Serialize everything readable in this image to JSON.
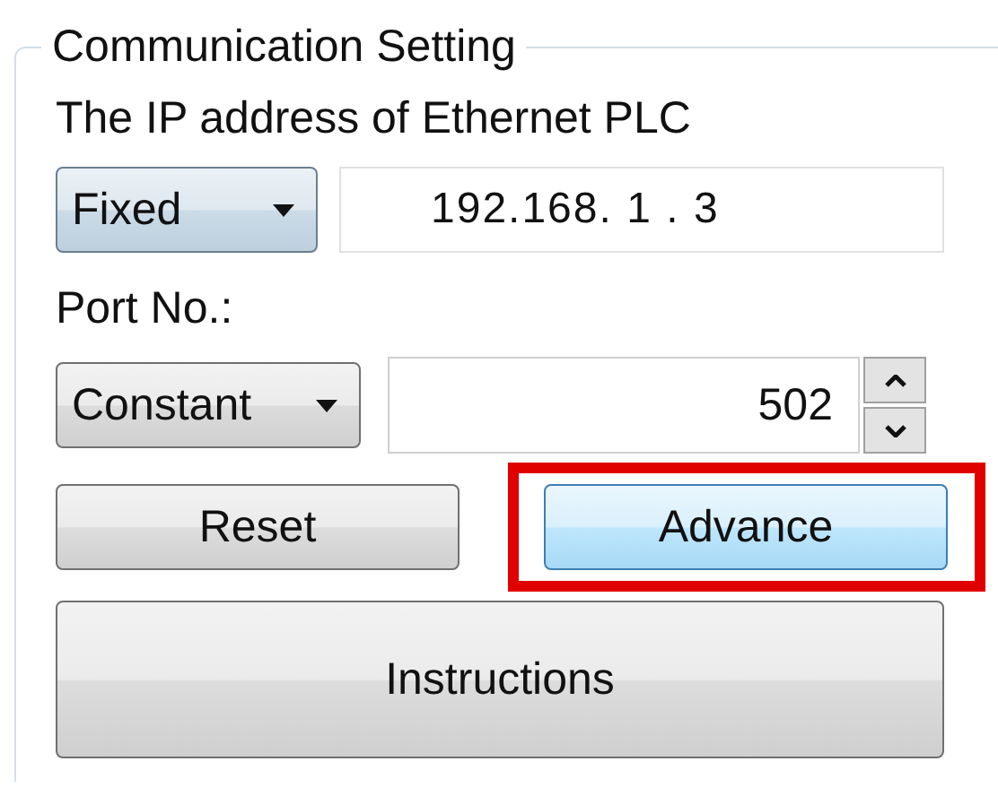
{
  "group": {
    "title": "Communication Setting"
  },
  "ip": {
    "label": "The IP address of Ethernet PLC",
    "mode": "Fixed",
    "value": "192.168. 1 . 3"
  },
  "port": {
    "label": "Port No.:",
    "mode": "Constant",
    "value": "502"
  },
  "buttons": [
    {
      "label": "Reset",
      "focused": false,
      "highlighted": false
    },
    {
      "label": "Advance",
      "focused": true,
      "highlighted": true
    }
  ],
  "instructions_button": {
    "label": "Instructions"
  }
}
